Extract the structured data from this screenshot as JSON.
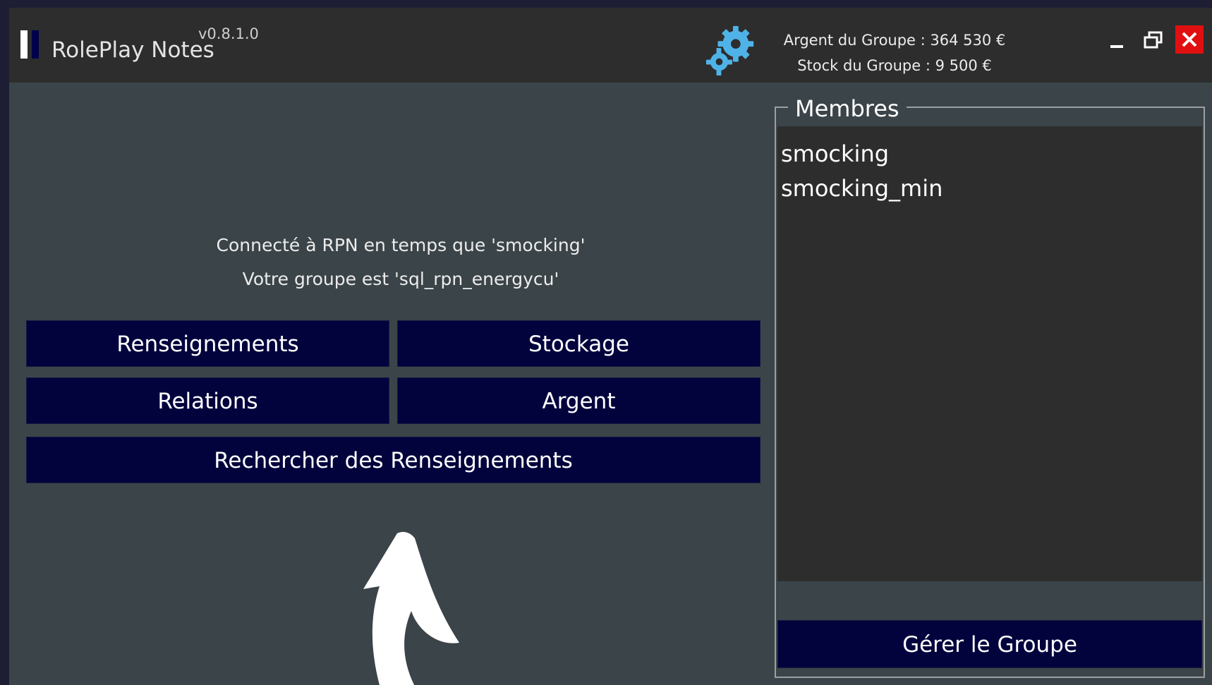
{
  "app": {
    "title": "RolePlay Notes",
    "version": "v0.8.1.0"
  },
  "header": {
    "group_money": "Argent du Groupe : 364 530 €",
    "group_stock": "Stock du Groupe : 9 500 €",
    "settings_icon": "gears-icon"
  },
  "window_controls": {
    "minimize_icon": "minimize-icon",
    "restore_icon": "restore-icon",
    "close_icon": "close-icon"
  },
  "status": {
    "connected": "Connecté à RPN en temps que 'smocking'",
    "group": "Votre groupe est 'sql_rpn_energycu'"
  },
  "buttons": {
    "renseignements": "Renseignements",
    "stockage": "Stockage",
    "relations": "Relations",
    "argent": "Argent",
    "rechercher": "Rechercher des Renseignements",
    "gerer": "Gérer le Groupe"
  },
  "members": {
    "legend": "Membres",
    "items": [
      "smocking",
      "smocking_min"
    ]
  },
  "colors": {
    "button_bg": "#02023d",
    "window_bg": "#3b4448",
    "titlebar_bg": "#2d2d2d",
    "close_red": "#e01010",
    "gear_blue": "#4fb3e8"
  }
}
